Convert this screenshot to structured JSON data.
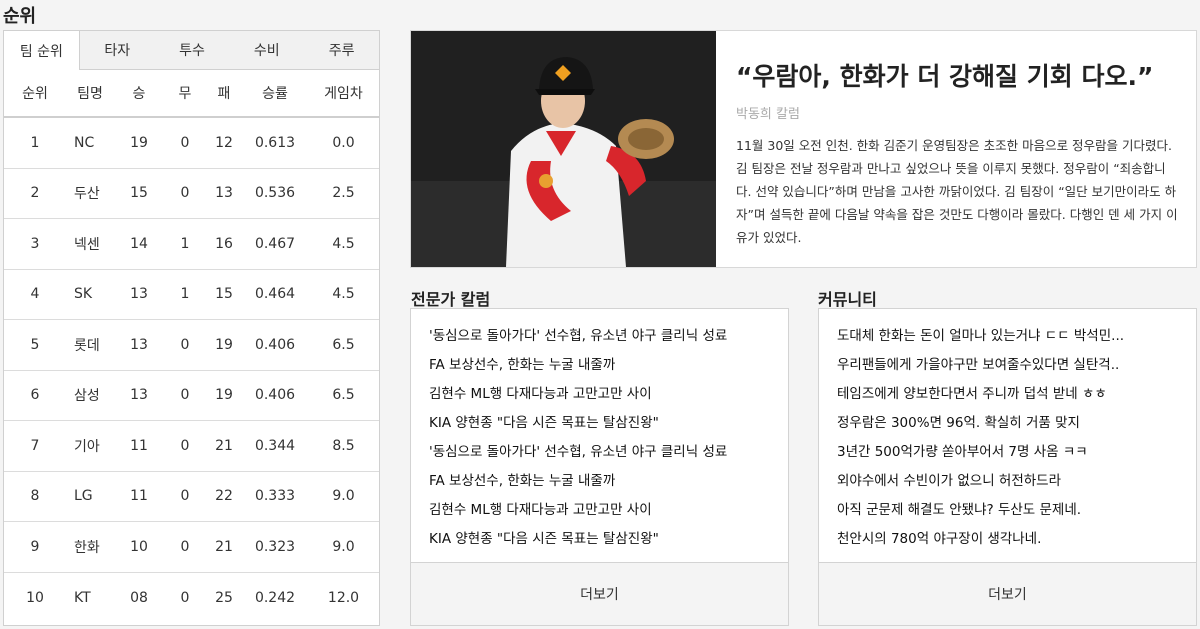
{
  "standings": {
    "title": "순위",
    "tabs": [
      "팀 순위",
      "타자",
      "투수",
      "수비",
      "주루"
    ],
    "headers": [
      "순위",
      "팀명",
      "승",
      "무",
      "패",
      "승률",
      "게임차"
    ],
    "rows": [
      [
        "1",
        "NC",
        "19",
        "0",
        "12",
        "0.613",
        "0.0"
      ],
      [
        "2",
        "두산",
        "15",
        "0",
        "13",
        "0.536",
        "2.5"
      ],
      [
        "3",
        "넥센",
        "14",
        "1",
        "16",
        "0.467",
        "4.5"
      ],
      [
        "4",
        "SK",
        "13",
        "1",
        "15",
        "0.464",
        "4.5"
      ],
      [
        "5",
        "롯데",
        "13",
        "0",
        "19",
        "0.406",
        "6.5"
      ],
      [
        "6",
        "삼성",
        "13",
        "0",
        "19",
        "0.406",
        "6.5"
      ],
      [
        "7",
        "기아",
        "11",
        "0",
        "21",
        "0.344",
        "8.5"
      ],
      [
        "8",
        "LG",
        "11",
        "0",
        "22",
        "0.333",
        "9.0"
      ],
      [
        "9",
        "한화",
        "10",
        "0",
        "21",
        "0.323",
        "9.0"
      ],
      [
        "10",
        "KT",
        "08",
        "0",
        "25",
        "0.242",
        "12.0"
      ]
    ]
  },
  "feature": {
    "headline": "“우람아, 한화가 더 강해질 기회 다오.”",
    "byline": "박동희 칼럼",
    "body": "11월 30일 오전 인천. 한화 김준기 운영팀장은 초조한 마음으로 정우람을 기다렸다. 김 팀장은 전날 정우람과 만나고 싶었으나 뜻을 이루지 못했다. 정우람이 “죄송합니다. 선약 있습니다”하며 만남을 고사한 까닭이었다. 김 팀장이 “일단 보기만이라도 하자”며 설득한 끝에 다음날 약속을 잡은 것만도 다행이라 몰랐다. 다행인 덴 세 가지 이유가 있었다."
  },
  "expert_column": {
    "title": "전문가 칼럼",
    "items": [
      "'동심으로 돌아가다' 선수협, 유소년 야구 클리닉 성료",
      "FA 보상선수, 한화는 누굴 내줄까",
      "김현수 ML행 다재다능과 고만고만 사이",
      "KIA 양현종 \"다음 시즌 목표는 탈삼진왕\"",
      "'동심으로 돌아가다' 선수협, 유소년 야구 클리닉 성료",
      "FA 보상선수, 한화는 누굴 내줄까",
      "김현수 ML행 다재다능과 고만고만 사이",
      "KIA 양현종 \"다음 시즌 목표는 탈삼진왕\""
    ],
    "more_label": "더보기"
  },
  "community": {
    "title": "커뮤니티",
    "items": [
      "도대체 한화는 돈이 얼마나 있는거냐 ㄷㄷ 박석민...",
      "우리팬들에게 가을야구만 보여줄수있다면 실탄걱..",
      "테임즈에게 양보한다면서 주니까 덥석 받네 ㅎㅎ",
      "정우람은 300%면 96억. 확실히 거품 맞지",
      "3년간 500억가량 쏟아부어서 7명 사옴 ㅋㅋ",
      "외야수에서 수빈이가 없으니 허전하드라",
      "아직 군문제 해결도 안됐냐? 두산도 문제네.",
      "천안시의 780억 야구장이 생각나네."
    ],
    "more_label": "더보기"
  }
}
